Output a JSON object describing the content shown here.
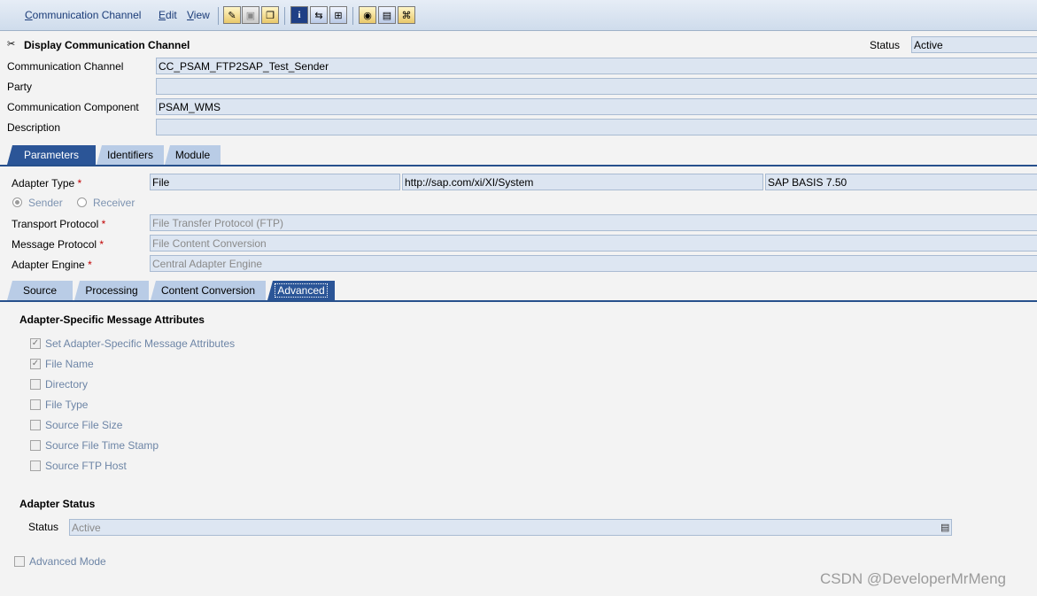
{
  "menu": {
    "items": [
      {
        "label": "Communication Channel"
      },
      {
        "label": "Edit"
      },
      {
        "label": "View"
      }
    ]
  },
  "toolbar": {
    "icons": [
      "edit-icon",
      "save-icon",
      "copy-icon",
      "info-icon",
      "where-used-icon",
      "compare-icon",
      "check-icon",
      "print-icon",
      "history-icon"
    ]
  },
  "header": {
    "title": "Display Communication Channel",
    "status_label": "Status",
    "status_value": "Active",
    "fields": [
      {
        "label": "Communication Channel",
        "value": "CC_PSAM_FTP2SAP_Test_Sender"
      },
      {
        "label": "Party",
        "value": ""
      },
      {
        "label": "Communication Component",
        "value": "PSAM_WMS"
      },
      {
        "label": "Description",
        "value": ""
      }
    ]
  },
  "main_tabs": [
    "Parameters",
    "Identifiers",
    "Module"
  ],
  "parameters": {
    "adapter_type_label": "Adapter Type",
    "adapter_type": "File",
    "adapter_namespace": "http://sap.com/xi/XI/System",
    "adapter_swcv": "SAP BASIS 7.50",
    "req_mark": "*",
    "sender_label": "Sender",
    "receiver_label": "Receiver",
    "transport_protocol_label": "Transport Protocol",
    "transport_protocol": "File Transfer Protocol (FTP)",
    "message_protocol_label": "Message Protocol",
    "message_protocol": "File Content Conversion",
    "adapter_engine_label": "Adapter Engine",
    "adapter_engine": "Central Adapter Engine"
  },
  "sub_tabs": [
    "Source",
    "Processing",
    "Content Conversion",
    "Advanced"
  ],
  "advanced": {
    "asma_title": "Adapter-Specific Message Attributes",
    "attributes": [
      {
        "label": "Set Adapter-Specific Message Attributes",
        "checked": true
      },
      {
        "label": "File Name",
        "checked": true
      },
      {
        "label": "Directory",
        "checked": false
      },
      {
        "label": "File Type",
        "checked": false
      },
      {
        "label": "Source File Size",
        "checked": false
      },
      {
        "label": "Source File Time Stamp",
        "checked": false
      },
      {
        "label": "Source FTP Host",
        "checked": false
      }
    ],
    "adapter_status_title": "Adapter Status",
    "status_label": "Status",
    "status_value": "Active",
    "advanced_mode_label": "Advanced Mode"
  },
  "watermark": "CSDN @DeveloperMrMeng"
}
